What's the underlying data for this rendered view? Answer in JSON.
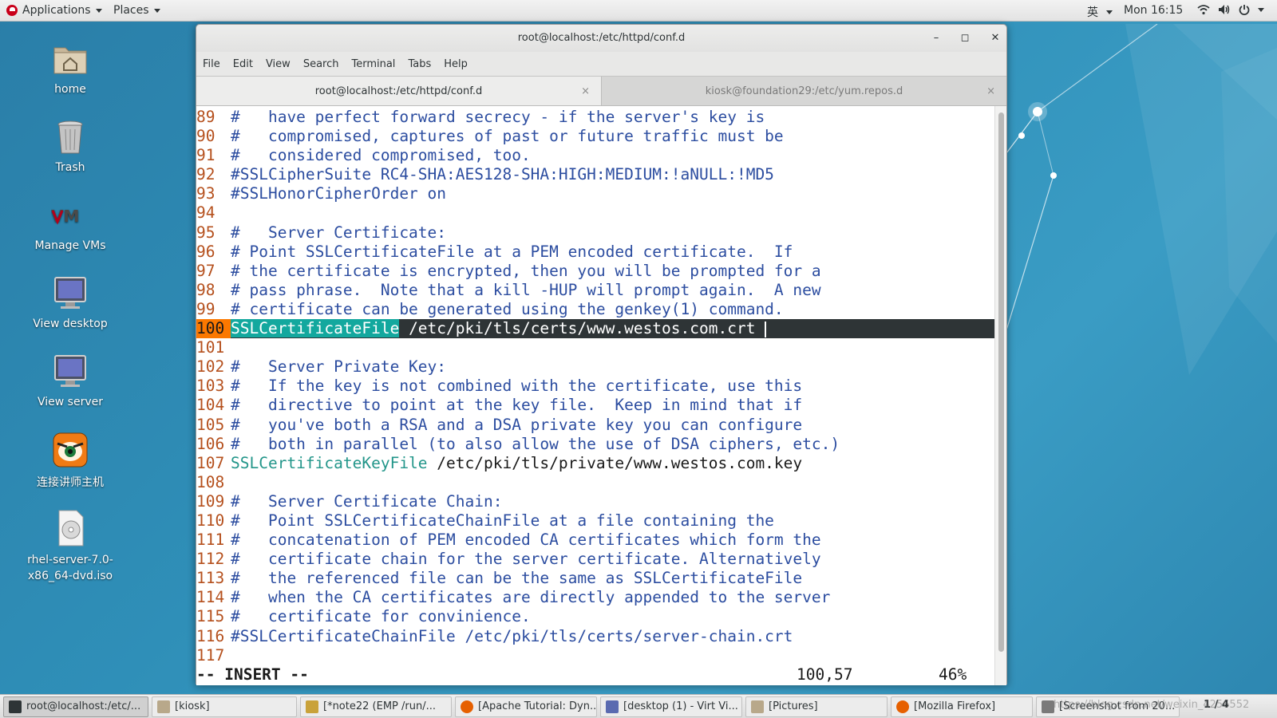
{
  "top_panel": {
    "applications_label": "Applications",
    "places_label": "Places",
    "input_method": "英",
    "clock": "Mon 16:15"
  },
  "desktop_icons": [
    {
      "label": "home",
      "icon": "home-folder-icon"
    },
    {
      "label": "Trash",
      "icon": "trash-icon"
    },
    {
      "label": "Manage VMs",
      "icon": "vmm-icon"
    },
    {
      "label": "View desktop",
      "icon": "monitor-icon"
    },
    {
      "label": "View server",
      "icon": "monitor-icon"
    },
    {
      "label": "连接讲师主机",
      "icon": "remote-app-icon"
    },
    {
      "label": "rhel-server-7.0-x86_64-dvd.iso",
      "icon": "disc-image-icon"
    }
  ],
  "window": {
    "title": "root@localhost:/etc/httpd/conf.d",
    "minimize_glyph": "–",
    "maximize_glyph": "◻",
    "close_glyph": "✕",
    "menu": [
      "File",
      "Edit",
      "View",
      "Search",
      "Terminal",
      "Tabs",
      "Help"
    ],
    "tabs": [
      {
        "label": "root@localhost:/etc/httpd/conf.d",
        "active": true
      },
      {
        "label": "kiosk@foundation29:/etc/yum.repos.d",
        "active": false
      }
    ],
    "tab_close_glyph": "×"
  },
  "terminal": {
    "lines": [
      {
        "n": "89",
        "kind": "comment",
        "text": "#   have perfect forward secrecy - if the server's key is"
      },
      {
        "n": "90",
        "kind": "comment",
        "text": "#   compromised, captures of past or future traffic must be"
      },
      {
        "n": "91",
        "kind": "comment",
        "text": "#   considered compromised, too."
      },
      {
        "n": "92",
        "kind": "comment",
        "text": "#SSLCipherSuite RC4-SHA:AES128-SHA:HIGH:MEDIUM:!aNULL:!MD5"
      },
      {
        "n": "93",
        "kind": "comment",
        "text": "#SSLHonorCipherOrder on"
      },
      {
        "n": "94",
        "kind": "blank",
        "text": ""
      },
      {
        "n": "95",
        "kind": "comment",
        "text": "#   Server Certificate:"
      },
      {
        "n": "96",
        "kind": "comment",
        "text": "# Point SSLCertificateFile at a PEM encoded certificate.  If"
      },
      {
        "n": "97",
        "kind": "comment",
        "text": "# the certificate is encrypted, then you will be prompted for a"
      },
      {
        "n": "98",
        "kind": "comment",
        "text": "# pass phrase.  Note that a kill -HUP will prompt again.  A new"
      },
      {
        "n": "99",
        "kind": "comment",
        "text": "# certificate can be generated using the genkey(1) command."
      },
      {
        "n": "100",
        "kind": "current",
        "keyword": "SSLCertificateFile",
        "text": " /etc/pki/tls/certs/www.westos.com.crt"
      },
      {
        "n": "101",
        "kind": "blank",
        "text": ""
      },
      {
        "n": "102",
        "kind": "comment",
        "text": "#   Server Private Key:"
      },
      {
        "n": "103",
        "kind": "comment",
        "text": "#   If the key is not combined with the certificate, use this"
      },
      {
        "n": "104",
        "kind": "comment",
        "text": "#   directive to point at the key file.  Keep in mind that if"
      },
      {
        "n": "105",
        "kind": "comment",
        "text": "#   you've both a RSA and a DSA private key you can configure"
      },
      {
        "n": "106",
        "kind": "comment",
        "text": "#   both in parallel (to also allow the use of DSA ciphers, etc.)"
      },
      {
        "n": "107",
        "kind": "directive",
        "keyword": "SSLCertificateKeyFile",
        "text": " /etc/pki/tls/private/www.westos.com.key"
      },
      {
        "n": "108",
        "kind": "blank",
        "text": ""
      },
      {
        "n": "109",
        "kind": "comment",
        "text": "#   Server Certificate Chain:"
      },
      {
        "n": "110",
        "kind": "comment",
        "text": "#   Point SSLCertificateChainFile at a file containing the"
      },
      {
        "n": "111",
        "kind": "comment",
        "text": "#   concatenation of PEM encoded CA certificates which form the"
      },
      {
        "n": "112",
        "kind": "comment",
        "text": "#   certificate chain for the server certificate. Alternatively"
      },
      {
        "n": "113",
        "kind": "comment",
        "text": "#   the referenced file can be the same as SSLCertificateFile"
      },
      {
        "n": "114",
        "kind": "comment",
        "text": "#   when the CA certificates are directly appended to the server"
      },
      {
        "n": "115",
        "kind": "comment",
        "text": "#   certificate for convinience."
      },
      {
        "n": "116",
        "kind": "comment",
        "text": "#SSLCertificateChainFile /etc/pki/tls/certs/server-chain.crt"
      },
      {
        "n": "117",
        "kind": "blank",
        "text": ""
      }
    ],
    "mode": "-- INSERT --",
    "position": "100,57",
    "percent": "46%"
  },
  "taskbar": [
    {
      "label": "root@localhost:/etc/...",
      "icon": "terminal-icon",
      "active": true
    },
    {
      "label": "[kiosk]",
      "icon": "folder-icon",
      "active": false
    },
    {
      "label": "[*note22 (EMP /run/...",
      "icon": "text-editor-icon",
      "active": false
    },
    {
      "label": "[Apache Tutorial: Dyn...",
      "icon": "firefox-icon",
      "active": false
    },
    {
      "label": "[desktop (1) - Virt Vi...",
      "icon": "monitor-icon",
      "active": false
    },
    {
      "label": "[Pictures]",
      "icon": "folder-icon",
      "active": false
    },
    {
      "label": "[Mozilla Firefox]",
      "icon": "firefox-icon",
      "active": false
    },
    {
      "label": "[Screenshot from 20...",
      "icon": "screenshot-icon",
      "active": false
    }
  ],
  "workspace": "1 / 4",
  "watermark": "https://blog.csdn.net/weixin_4256552",
  "colors": {
    "line_number": "#b5501d",
    "comment": "#2c4da0",
    "keyword": "#23968a",
    "cursor_line_bg": "#2e3436",
    "cursor_ln_bg": "#fb7800"
  }
}
